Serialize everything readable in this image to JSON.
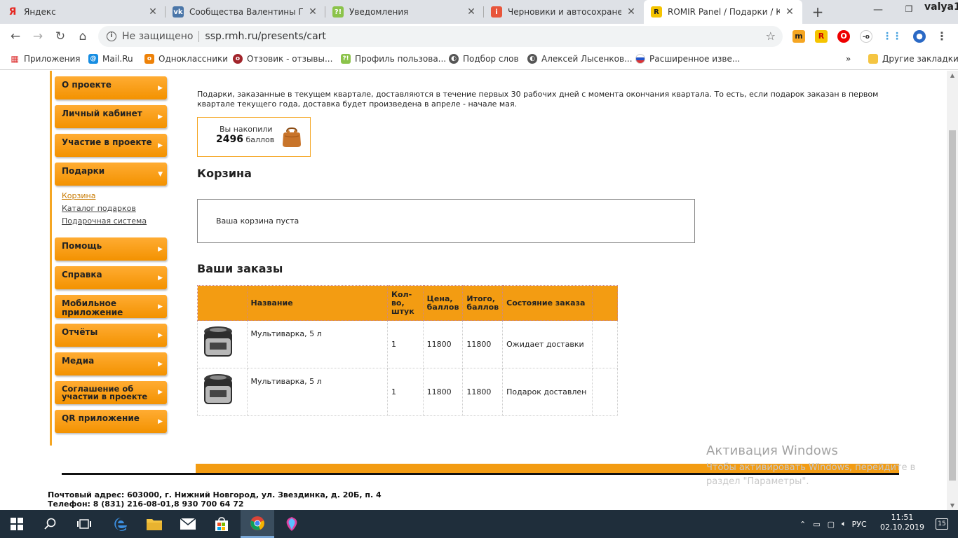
{
  "browser": {
    "tabs": [
      {
        "title": "Яндекс",
        "favicon_text": "Я",
        "favicon_color": "#ffffff"
      },
      {
        "title": "Сообщества Валентины Пилу",
        "favicon_text": "vk",
        "favicon_color": "#4a76a8"
      },
      {
        "title": "Уведомления",
        "favicon_text": "?!",
        "favicon_color": "#8bc34a"
      },
      {
        "title": "Черновики и автосохранения",
        "favicon_text": "i",
        "favicon_color": "#e8553b"
      },
      {
        "title": "ROMIR Panel / Подарки / Кор",
        "favicon_text": "R",
        "favicon_color": "#222222"
      }
    ],
    "profile_name": "valya1",
    "security_label": "Не защищено",
    "url": "ssp.rmh.ru/presents/cart",
    "extensions": [
      "m",
      "R",
      "O",
      "-o"
    ],
    "bookmarks": [
      {
        "label": "Приложения",
        "color": "#777"
      },
      {
        "label": "Mail.Ru",
        "color": "#168de2"
      },
      {
        "label": "Одноклассники",
        "color": "#ee8208"
      },
      {
        "label": "Отзовик - отзывы...",
        "color": "#a1242b"
      },
      {
        "label": "Профиль пользова...",
        "color": "#8bc34a"
      },
      {
        "label": "Подбор слов",
        "color": "#555"
      },
      {
        "label": "Алексей Лысенков...",
        "color": "#555"
      },
      {
        "label": "Расширенное изве...",
        "color": "#d33"
      }
    ],
    "other_bookmarks": "Другие закладки"
  },
  "sidebar": {
    "items": [
      {
        "label": "О проекте"
      },
      {
        "label": "Личный кабинет"
      },
      {
        "label": "Участие в проекте"
      },
      {
        "label": "Подарки"
      },
      {
        "label": "Помощь"
      },
      {
        "label": "Справка"
      },
      {
        "label": "Мобильное приложение"
      },
      {
        "label": "Отчёты"
      },
      {
        "label": "Медиа"
      },
      {
        "label": "Соглашение об участии в проекте"
      },
      {
        "label": "QR приложение"
      }
    ],
    "submenu": [
      "Корзина",
      "Каталог подарков",
      "Подарочная система"
    ]
  },
  "main": {
    "notice": "Подарки, заказанные в текущем квартале, доставляются в течение первых 30 рабочих дней с момента окончания квартала. То есть, если подарок заказан в первом квартале текущего года, доставка будет произведена в апреле - начале мая.",
    "balance_label": "Вы накопили",
    "balance_value": "2496",
    "balance_unit": "баллов",
    "cart_title": "Корзина",
    "cart_empty": "Ваша корзина пуста",
    "orders_title": "Ваши заказы",
    "orders_columns": [
      "",
      "Название",
      "Кол-во, штук",
      "Цена, баллов",
      "Итого, баллов",
      "Состояние заказа",
      ""
    ],
    "orders": [
      {
        "name": "Мультиварка, 5 л",
        "qty": "1",
        "price": "11800",
        "total": "11800",
        "status": "Ожидает доставки"
      },
      {
        "name": "Мультиварка, 5 л",
        "qty": "1",
        "price": "11800",
        "total": "11800",
        "status": "Подарок доставлен"
      }
    ]
  },
  "footer": {
    "address_label": "Почтовый адрес:",
    "address": "603000, г. Нижний Новгород, ул. Звездинка, д. 20Б, п. 4",
    "phone_label": "Телефон:",
    "phone": "8 (831) 216-08-01,8 930 700 64 72"
  },
  "os": {
    "activation_title": "Активация Windows",
    "activation_text": "Чтобы активировать Windows, перейдите в раздел \"Параметры\".",
    "time": "11:51",
    "date": "02.10.2019",
    "lang": "РУС",
    "notifications": "15"
  }
}
